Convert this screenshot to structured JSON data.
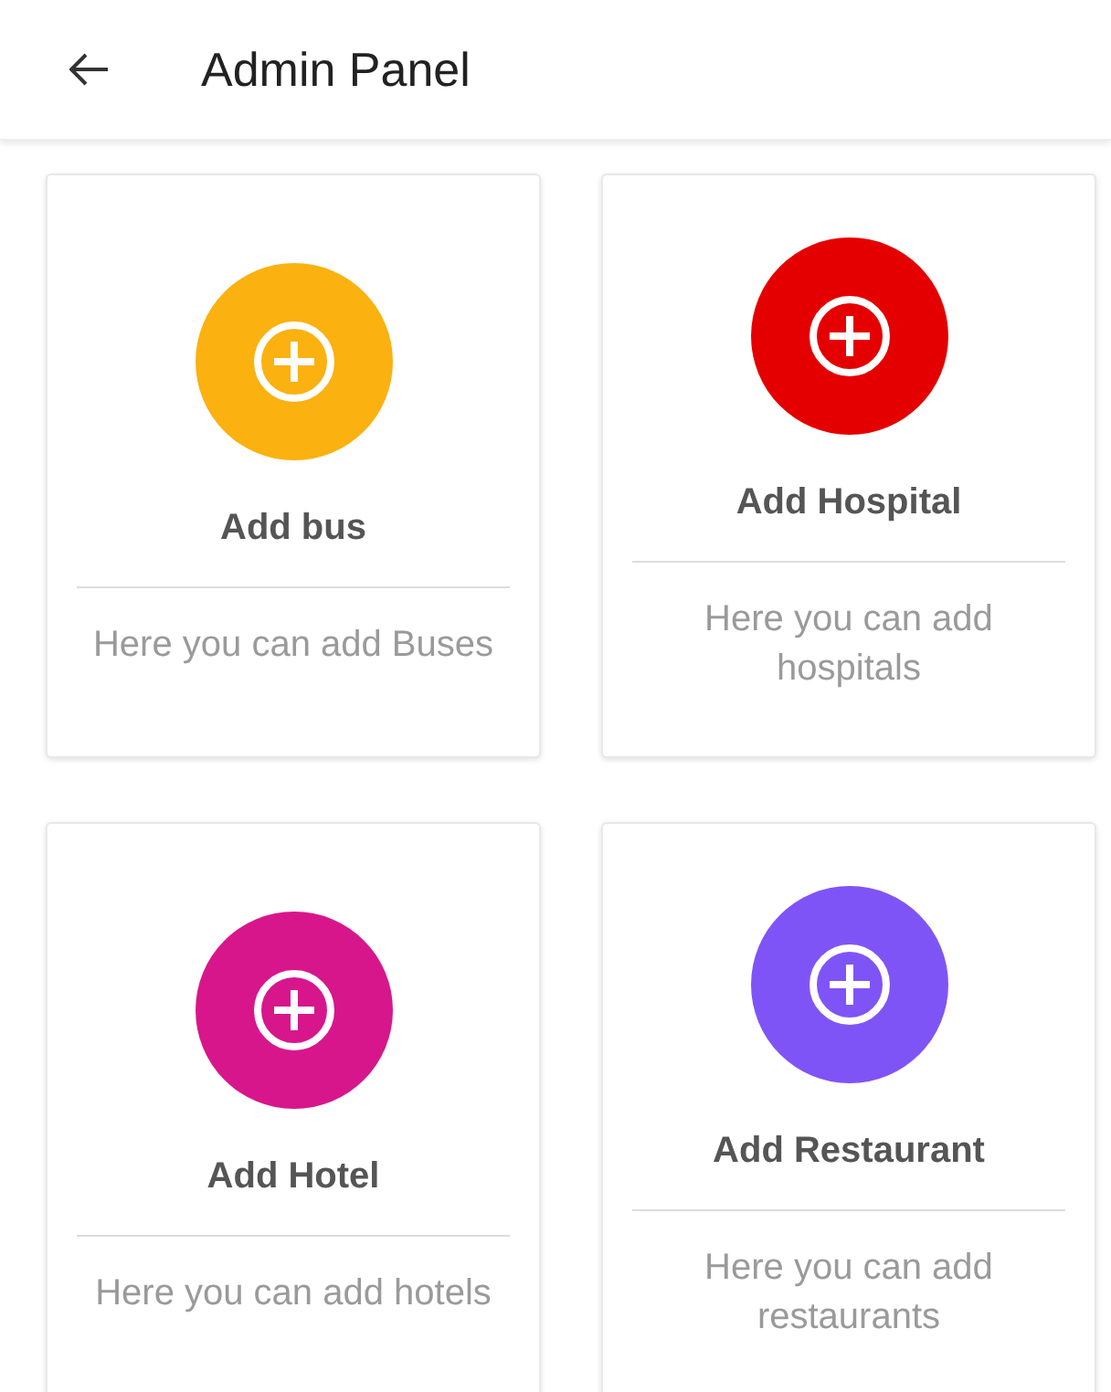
{
  "app_bar": {
    "title": "Admin Panel"
  },
  "cards": [
    {
      "title": "Add bus",
      "description": "Here you can add Buses",
      "color": "#fbb10f"
    },
    {
      "title": "Add Hospital",
      "description": "Here you can add hospitals",
      "color": "#e50000"
    },
    {
      "title": "Add Hotel",
      "description": "Here you can add hotels",
      "color": "#d8168c"
    },
    {
      "title": "Add Restaurant",
      "description": "Here you can add restaurants",
      "color": "#7f54f6"
    }
  ]
}
